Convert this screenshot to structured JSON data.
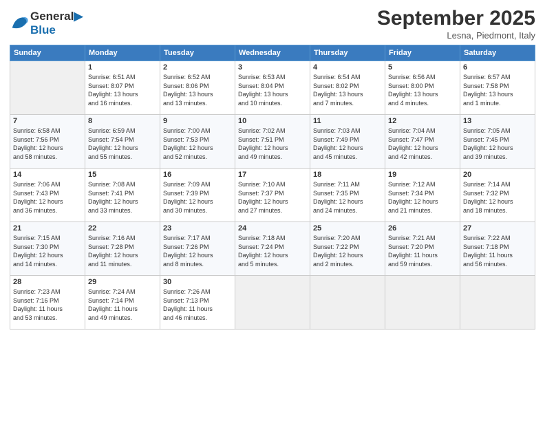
{
  "header": {
    "logo_line1": "General",
    "logo_line2": "Blue",
    "month": "September 2025",
    "location": "Lesna, Piedmont, Italy"
  },
  "weekdays": [
    "Sunday",
    "Monday",
    "Tuesday",
    "Wednesday",
    "Thursday",
    "Friday",
    "Saturday"
  ],
  "weeks": [
    [
      {
        "day": "",
        "info": ""
      },
      {
        "day": "1",
        "info": "Sunrise: 6:51 AM\nSunset: 8:07 PM\nDaylight: 13 hours\nand 16 minutes."
      },
      {
        "day": "2",
        "info": "Sunrise: 6:52 AM\nSunset: 8:06 PM\nDaylight: 13 hours\nand 13 minutes."
      },
      {
        "day": "3",
        "info": "Sunrise: 6:53 AM\nSunset: 8:04 PM\nDaylight: 13 hours\nand 10 minutes."
      },
      {
        "day": "4",
        "info": "Sunrise: 6:54 AM\nSunset: 8:02 PM\nDaylight: 13 hours\nand 7 minutes."
      },
      {
        "day": "5",
        "info": "Sunrise: 6:56 AM\nSunset: 8:00 PM\nDaylight: 13 hours\nand 4 minutes."
      },
      {
        "day": "6",
        "info": "Sunrise: 6:57 AM\nSunset: 7:58 PM\nDaylight: 13 hours\nand 1 minute."
      }
    ],
    [
      {
        "day": "7",
        "info": "Sunrise: 6:58 AM\nSunset: 7:56 PM\nDaylight: 12 hours\nand 58 minutes."
      },
      {
        "day": "8",
        "info": "Sunrise: 6:59 AM\nSunset: 7:54 PM\nDaylight: 12 hours\nand 55 minutes."
      },
      {
        "day": "9",
        "info": "Sunrise: 7:00 AM\nSunset: 7:53 PM\nDaylight: 12 hours\nand 52 minutes."
      },
      {
        "day": "10",
        "info": "Sunrise: 7:02 AM\nSunset: 7:51 PM\nDaylight: 12 hours\nand 49 minutes."
      },
      {
        "day": "11",
        "info": "Sunrise: 7:03 AM\nSunset: 7:49 PM\nDaylight: 12 hours\nand 45 minutes."
      },
      {
        "day": "12",
        "info": "Sunrise: 7:04 AM\nSunset: 7:47 PM\nDaylight: 12 hours\nand 42 minutes."
      },
      {
        "day": "13",
        "info": "Sunrise: 7:05 AM\nSunset: 7:45 PM\nDaylight: 12 hours\nand 39 minutes."
      }
    ],
    [
      {
        "day": "14",
        "info": "Sunrise: 7:06 AM\nSunset: 7:43 PM\nDaylight: 12 hours\nand 36 minutes."
      },
      {
        "day": "15",
        "info": "Sunrise: 7:08 AM\nSunset: 7:41 PM\nDaylight: 12 hours\nand 33 minutes."
      },
      {
        "day": "16",
        "info": "Sunrise: 7:09 AM\nSunset: 7:39 PM\nDaylight: 12 hours\nand 30 minutes."
      },
      {
        "day": "17",
        "info": "Sunrise: 7:10 AM\nSunset: 7:37 PM\nDaylight: 12 hours\nand 27 minutes."
      },
      {
        "day": "18",
        "info": "Sunrise: 7:11 AM\nSunset: 7:35 PM\nDaylight: 12 hours\nand 24 minutes."
      },
      {
        "day": "19",
        "info": "Sunrise: 7:12 AM\nSunset: 7:34 PM\nDaylight: 12 hours\nand 21 minutes."
      },
      {
        "day": "20",
        "info": "Sunrise: 7:14 AM\nSunset: 7:32 PM\nDaylight: 12 hours\nand 18 minutes."
      }
    ],
    [
      {
        "day": "21",
        "info": "Sunrise: 7:15 AM\nSunset: 7:30 PM\nDaylight: 12 hours\nand 14 minutes."
      },
      {
        "day": "22",
        "info": "Sunrise: 7:16 AM\nSunset: 7:28 PM\nDaylight: 12 hours\nand 11 minutes."
      },
      {
        "day": "23",
        "info": "Sunrise: 7:17 AM\nSunset: 7:26 PM\nDaylight: 12 hours\nand 8 minutes."
      },
      {
        "day": "24",
        "info": "Sunrise: 7:18 AM\nSunset: 7:24 PM\nDaylight: 12 hours\nand 5 minutes."
      },
      {
        "day": "25",
        "info": "Sunrise: 7:20 AM\nSunset: 7:22 PM\nDaylight: 12 hours\nand 2 minutes."
      },
      {
        "day": "26",
        "info": "Sunrise: 7:21 AM\nSunset: 7:20 PM\nDaylight: 11 hours\nand 59 minutes."
      },
      {
        "day": "27",
        "info": "Sunrise: 7:22 AM\nSunset: 7:18 PM\nDaylight: 11 hours\nand 56 minutes."
      }
    ],
    [
      {
        "day": "28",
        "info": "Sunrise: 7:23 AM\nSunset: 7:16 PM\nDaylight: 11 hours\nand 53 minutes."
      },
      {
        "day": "29",
        "info": "Sunrise: 7:24 AM\nSunset: 7:14 PM\nDaylight: 11 hours\nand 49 minutes."
      },
      {
        "day": "30",
        "info": "Sunrise: 7:26 AM\nSunset: 7:13 PM\nDaylight: 11 hours\nand 46 minutes."
      },
      {
        "day": "",
        "info": ""
      },
      {
        "day": "",
        "info": ""
      },
      {
        "day": "",
        "info": ""
      },
      {
        "day": "",
        "info": ""
      }
    ]
  ]
}
